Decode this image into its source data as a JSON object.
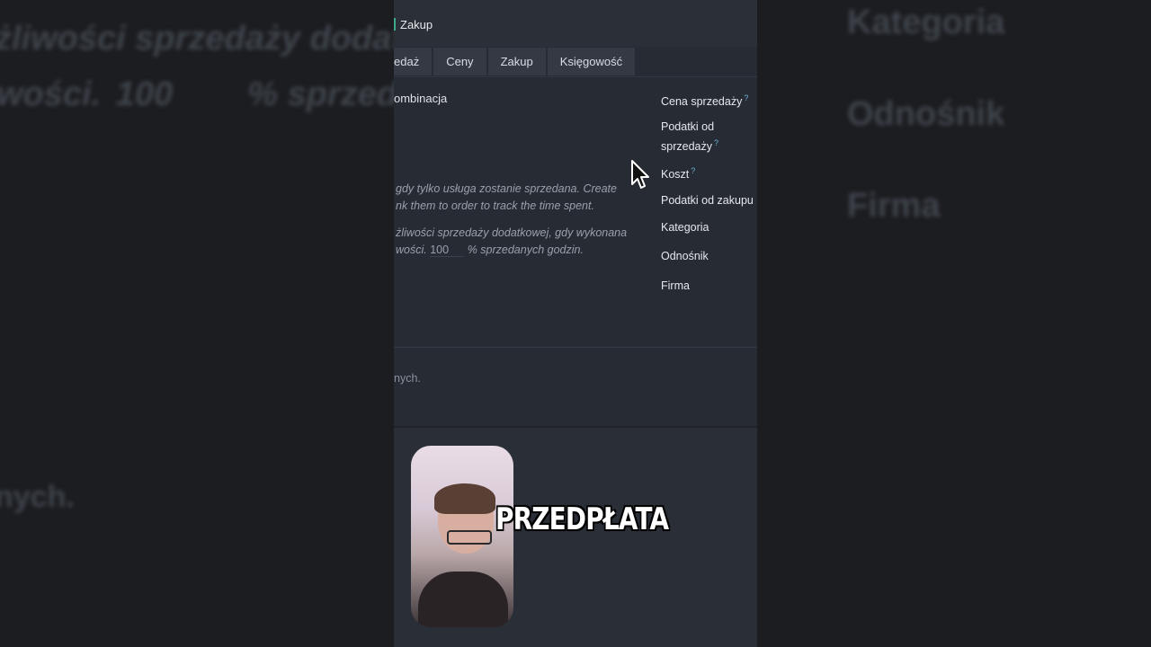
{
  "window": {
    "title": "Zakup"
  },
  "tabs": [
    {
      "label": "edaż"
    },
    {
      "label": "Ceny"
    },
    {
      "label": "Zakup"
    },
    {
      "label": "Księgowość"
    }
  ],
  "form": {
    "combination_label": "ombinacja",
    "desc_line1": "gdy tylko usługa zostanie sprzedana. Create",
    "desc_line2": "nk them to order to track the time spent.",
    "desc_line3": "żliwości sprzedaży dodatkowej, gdy wykonana",
    "desc_line4_prefix": "wości.",
    "desc_line4_value": "100",
    "desc_line4_suffix": "% sprzedanych godzin.",
    "footer_text": "nych."
  },
  "right_labels": {
    "sale_price": "Cena sprzedaży",
    "sales_taxes_1": "Podatki od",
    "sales_taxes_2": "sprzedaży",
    "cost": "Koszt",
    "purchase_taxes": "Podatki od zakupu",
    "category": "Kategoria",
    "reference": "Odnośnik",
    "company": "Firma",
    "help_mark": "?"
  },
  "background": {
    "left_line1": "żliwości sprzedaży dodat",
    "left_line2_prefix": "wości.",
    "left_line2_value": "100",
    "left_line2_suffix": "% sprzeda",
    "left_line3": "nych.",
    "right_line1": "Kategoria",
    "right_line2": "Odnośnik",
    "right_line3": "Firma"
  },
  "caption": "PRZEDPŁATA",
  "colors": {
    "panel_bg": "#272b33",
    "accent": "#3fa78a",
    "help": "#6fb3d9"
  }
}
